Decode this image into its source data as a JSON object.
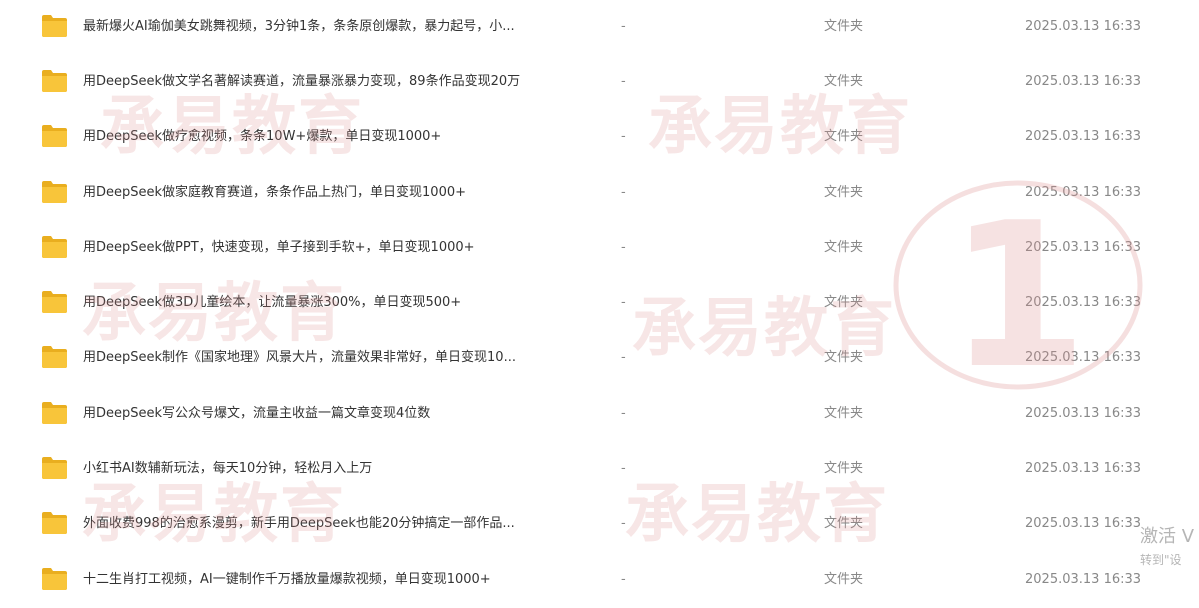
{
  "files": [
    {
      "name": "最新爆火AI瑜伽美女跳舞视频，3分钟1条，条条原创爆款，暴力起号，小...",
      "size": "-",
      "type": "文件夹",
      "date": "2025.03.13 16:33"
    },
    {
      "name": "用DeepSeek做文学名著解读赛道，流量暴涨暴力变现，89条作品变现20万",
      "size": "-",
      "type": "文件夹",
      "date": "2025.03.13 16:33"
    },
    {
      "name": "用DeepSeek做疗愈视频，条条10W+爆款，单日变现1000+",
      "size": "-",
      "type": "文件夹",
      "date": "2025.03.13 16:33"
    },
    {
      "name": "用DeepSeek做家庭教育赛道，条条作品上热门，单日变现1000+",
      "size": "-",
      "type": "文件夹",
      "date": "2025.03.13 16:33"
    },
    {
      "name": "用DeepSeek做PPT，快速变现，单子接到手软+，单日变现1000+",
      "size": "-",
      "type": "文件夹",
      "date": "2025.03.13 16:33"
    },
    {
      "name": "用DeepSeek做3D儿童绘本，让流量暴涨300%，单日变现500+",
      "size": "-",
      "type": "文件夹",
      "date": "2025.03.13 16:33"
    },
    {
      "name": "用DeepSeek制作《国家地理》风景大片，流量效果非常好，单日变现10...",
      "size": "-",
      "type": "文件夹",
      "date": "2025.03.13 16:33"
    },
    {
      "name": "用DeepSeek写公众号爆文，流量主收益一篇文章变现4位数",
      "size": "-",
      "type": "文件夹",
      "date": "2025.03.13 16:33"
    },
    {
      "name": "小红书AI数辅新玩法，每天10分钟，轻松月入上万",
      "size": "-",
      "type": "文件夹",
      "date": "2025.03.13 16:33"
    },
    {
      "name": "外面收费998的治愈系漫剪，新手用DeepSeek也能20分钟搞定一部作品...",
      "size": "-",
      "type": "文件夹",
      "date": "2025.03.13 16:33"
    },
    {
      "name": "十二生肖打工视频，AI一键制作千万播放量爆款视频，单日变现1000+",
      "size": "-",
      "type": "文件夹",
      "date": "2025.03.13 16:33"
    }
  ],
  "watermark": {
    "text": "承易教育",
    "badge_number": "1"
  },
  "activation": {
    "title": "激活 V",
    "subtitle": "转到\"设"
  },
  "colors": {
    "folder": "#f8c53a",
    "folder_dark": "#e9ae1f",
    "watermark": "#dc8c8c"
  },
  "icons": {
    "folder": "folder-icon"
  }
}
